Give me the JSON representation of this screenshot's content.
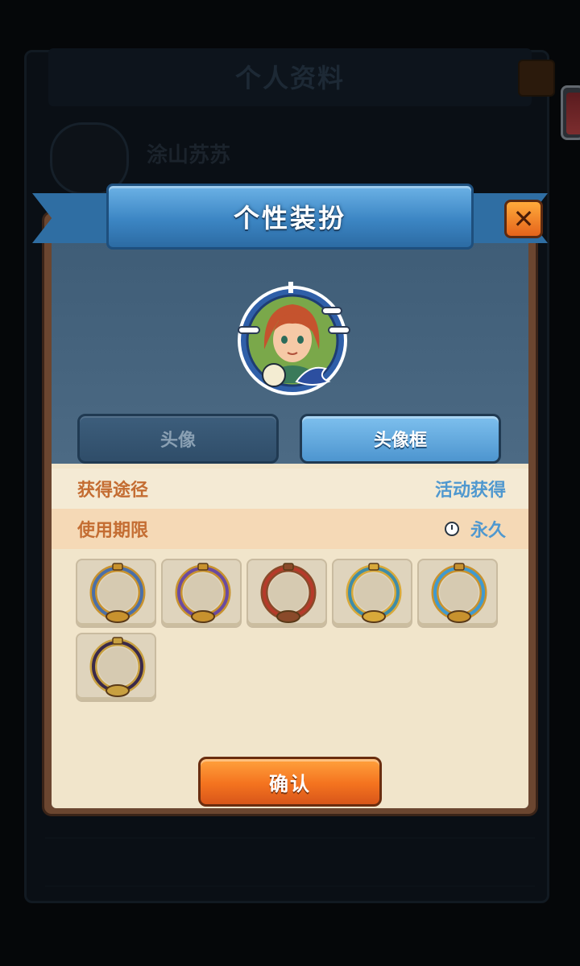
{
  "background": {
    "title": "个人资料",
    "player_name": "涂山苏苏"
  },
  "dialog": {
    "title": "个性装扮",
    "close_label": "✕"
  },
  "tabs": [
    {
      "label": "头像",
      "active": false
    },
    {
      "label": "头像框",
      "active": true
    }
  ],
  "info": {
    "source_label": "获得途径",
    "source_value": "活动获得",
    "duration_label": "使用期限",
    "duration_value": "永久"
  },
  "frames": [
    {
      "name": "gold-serpent-frame",
      "ring": "#4a6fa8",
      "gold": "#c8922e"
    },
    {
      "name": "purple-serpent-frame",
      "ring": "#6a4aa0",
      "gold": "#c8922e"
    },
    {
      "name": "horned-frame",
      "ring": "#b63a2a",
      "gold": "#8a4a2a"
    },
    {
      "name": "dragon-crown-frame",
      "ring": "#3e8ca8",
      "gold": "#d8a93a"
    },
    {
      "name": "brush-frame",
      "ring": "#3f9ad0",
      "gold": "#c8922e"
    },
    {
      "name": "winged-laurel-frame",
      "ring": "#3a2a4a",
      "gold": "#c8a040"
    }
  ],
  "confirm_label": "确认",
  "colors": {
    "accent_blue": "#4f98cf",
    "accent_orange": "#c46d32",
    "confirm_orange": "#f4731f"
  }
}
